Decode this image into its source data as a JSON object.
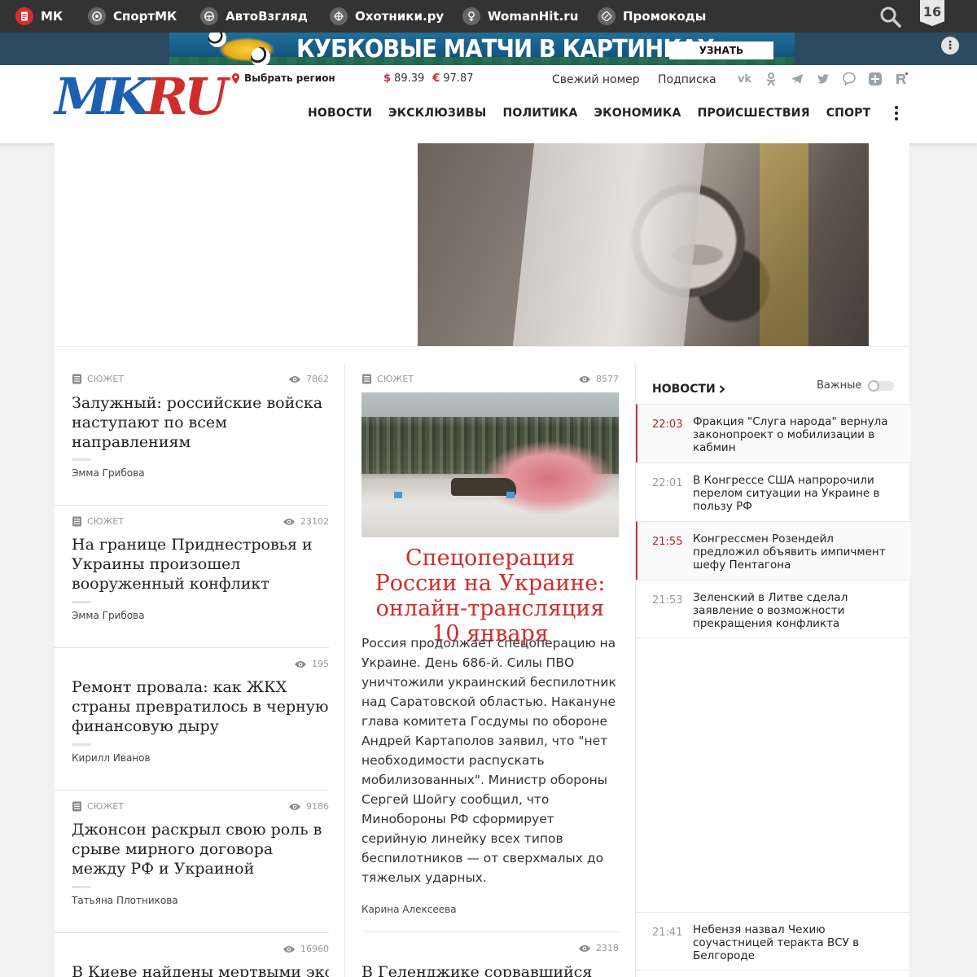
{
  "topbar": {
    "sites": [
      {
        "label": "МК",
        "icon": "mk-document-icon"
      },
      {
        "label": "СпортМК",
        "icon": "soccer-ball-icon"
      },
      {
        "label": "АвтоВзгляд",
        "icon": "steering-wheel-icon"
      },
      {
        "label": "Охотники.ру",
        "icon": "crosshair-icon"
      },
      {
        "label": "WomanHit.ru",
        "icon": "female-symbol-icon"
      },
      {
        "label": "Промокоды",
        "icon": "coupon-icon"
      }
    ],
    "age_rating": "16",
    "search_icon": "search-icon"
  },
  "banner": {
    "title": "КУБКОВЫЕ МАТЧИ В КАРТИНКАХ",
    "button": "УЗНАТЬ",
    "more_icon": "more-options-icon"
  },
  "header": {
    "region_label": "Выбрать регион",
    "usd_symbol": "$",
    "usd": "89.39",
    "eur_symbol": "€",
    "eur": "97.87",
    "fresh_issue": "Свежий номер",
    "subscription": "Подписка",
    "social_icons": [
      "vk-icon",
      "odnoklassniki-icon",
      "telegram-icon",
      "twitter-icon",
      "viber-icon",
      "plus-icon",
      "rutube-icon"
    ],
    "nav": [
      "НОВОСТИ",
      "ЭКСКЛЮЗИВЫ",
      "ПОЛИТИКА",
      "ЭКОНОМИКА",
      "ПРОИСШЕСТВИЯ",
      "СПОРТ"
    ],
    "colors": {
      "accent_red": "#d12c2c",
      "logo_blue": "#1d5fb0"
    }
  },
  "logo": {
    "mk": "MK",
    "ru": "RU"
  },
  "left_cards": [
    {
      "tag": "СЮЖЕТ",
      "views": "7862",
      "title": "Залужный: российские войска наступают по всем направлениям",
      "author": "Эмма Грибова"
    },
    {
      "tag": "СЮЖЕТ",
      "views": "23102",
      "title": "На границе Приднестровья и Украины произошел вооруженный конфликт",
      "author": "Эмма Грибова"
    },
    {
      "tag": "",
      "views": "195",
      "title": "Ремонт провала: как ЖКХ страны превратилось в черную финансовую дыру",
      "author": "Кирилл Иванов"
    },
    {
      "tag": "СЮЖЕТ",
      "views": "9186",
      "title": "Джонсон раскрыл свою роль в срыве мирного договора между РФ и Украиной",
      "author": "Татьяна Плотникова"
    },
    {
      "tag": "",
      "views": "16960",
      "title": "В Киеве найдены мертвыми экс-",
      "author": ""
    }
  ],
  "center": {
    "tag": "СЮЖЕТ",
    "views": "8577",
    "title": "Спецоперация России на Украине: онлайн-трансляция 10 января",
    "text": "Россия продолжает спецоперацию на Украине. День 686-й. Силы ПВО уничтожили украинский беспилотник над Саратовской областью. Накануне глава комитета Госдумы по обороне Андрей Картаполов заявил, что \"нет необходимости распускать мобилизованных\". Министр обороны Сергей Шойгу сообщил, что Минобороны РФ сформирует серийную линейку всех типов беспилотников — от сверхмалых до тяжелых ударных.",
    "author": "Карина Алексеева",
    "next_views": "2318",
    "next_title": "В Геленджике сорвавшийся"
  },
  "feed": {
    "title": "НОВОСТИ",
    "important_label": "Важные",
    "items": [
      {
        "time": "22:03",
        "text": "Фракция \"Слуга народа\" вернула законопроект о мобилизации в кабмин",
        "hot": true
      },
      {
        "time": "22:01",
        "text": "В Конгрессе США напророчили перелом ситуации на Украине в пользу РФ",
        "hot": false
      },
      {
        "time": "21:55",
        "text": "Конгрессмен Розендейл предложил объявить импичмент шефу Пентагона",
        "hot": true
      },
      {
        "time": "21:53",
        "text": "Зеленский в Литве сделал заявление о возможности прекращения конфликта",
        "hot": false
      },
      {
        "time": "21:41",
        "text": "Небензя назвал Чехию соучастницей теракта ВСУ в Белгороде",
        "hot": false
      }
    ]
  }
}
